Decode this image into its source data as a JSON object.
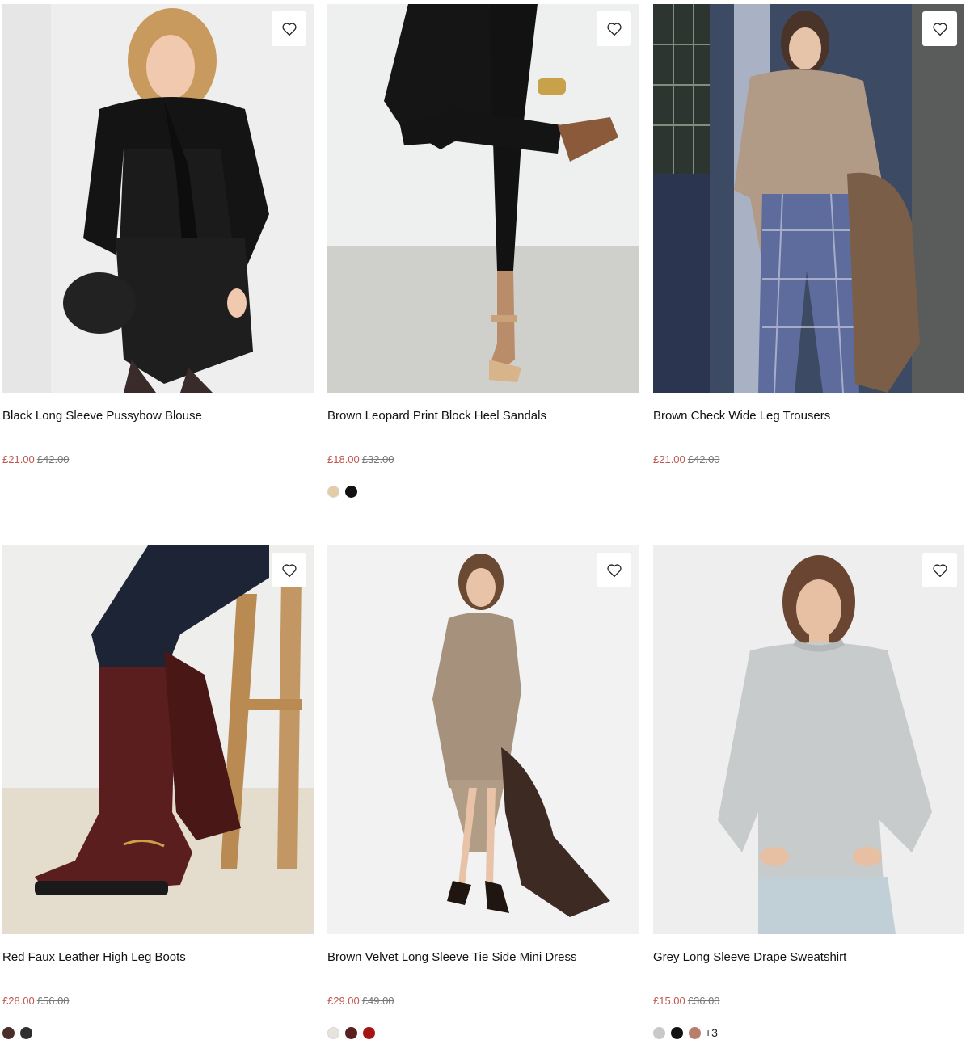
{
  "products": [
    {
      "title": "Black Long Sleeve Pussybow Blouse",
      "sale_price": "£21.00",
      "was_price": "£42.00",
      "swatches": [],
      "more": ""
    },
    {
      "title": "Brown Leopard Print Block Heel Sandals",
      "sale_price": "£18.00",
      "was_price": "£32.00",
      "swatches": [
        "#e3cca6",
        "#111111"
      ],
      "more": ""
    },
    {
      "title": "Brown Check Wide Leg Trousers",
      "sale_price": "£21.00",
      "was_price": "£42.00",
      "swatches": [],
      "more": ""
    },
    {
      "title": "Red Faux Leather High Leg Boots",
      "sale_price": "£28.00",
      "was_price": "£56.00",
      "swatches": [
        "#4a2e2a",
        "#2f2f2f"
      ],
      "more": ""
    },
    {
      "title": "Brown Velvet Long Sleeve Tie Side Mini Dress",
      "sale_price": "£29.00",
      "was_price": "£49.00",
      "swatches": [
        "#e6e3dc",
        "#5a1f1f",
        "#a51414"
      ],
      "more": ""
    },
    {
      "title": "Grey Long Sleeve Drape Sweatshirt",
      "sale_price": "£15.00",
      "was_price": "£36.00",
      "swatches": [
        "#c9c9c9",
        "#111111",
        "#b77d6d"
      ],
      "more": "+3"
    }
  ],
  "colors": {
    "sale": "#c0574f",
    "was": "#777777"
  },
  "icons": {
    "wishlist": "heart-icon"
  }
}
